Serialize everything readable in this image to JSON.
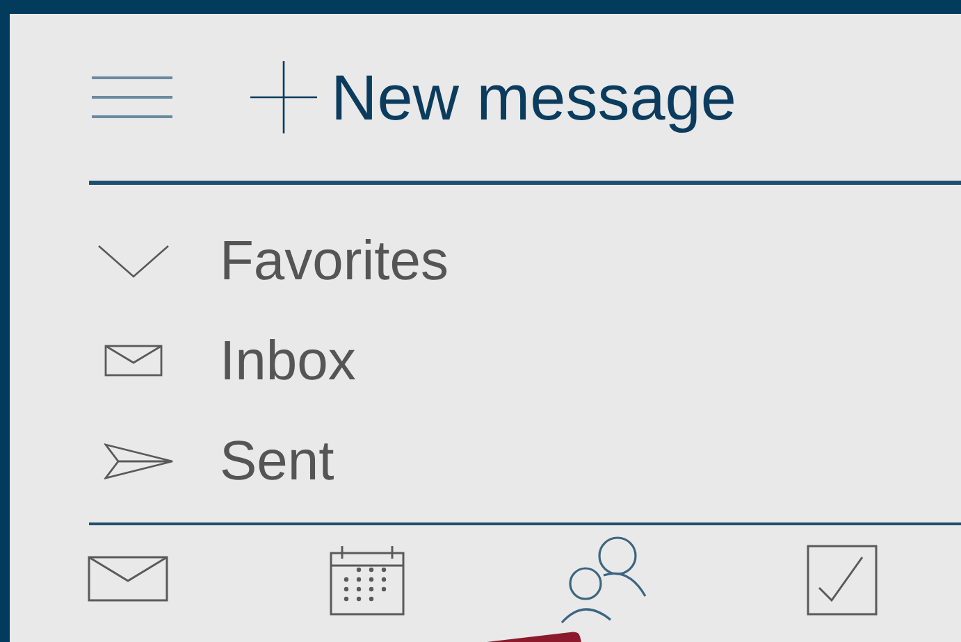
{
  "header": {
    "new_message": "New message"
  },
  "favorites": {
    "label": "Favorites",
    "expanded": true
  },
  "folders": [
    {
      "kind": "inbox",
      "label": "Inbox"
    },
    {
      "kind": "sent",
      "label": "Sent"
    }
  ],
  "bottom_tabs": [
    {
      "kind": "mail",
      "selected": false
    },
    {
      "kind": "calendar",
      "selected": false
    },
    {
      "kind": "people",
      "selected": true
    },
    {
      "kind": "tasks",
      "selected": false
    }
  ]
}
